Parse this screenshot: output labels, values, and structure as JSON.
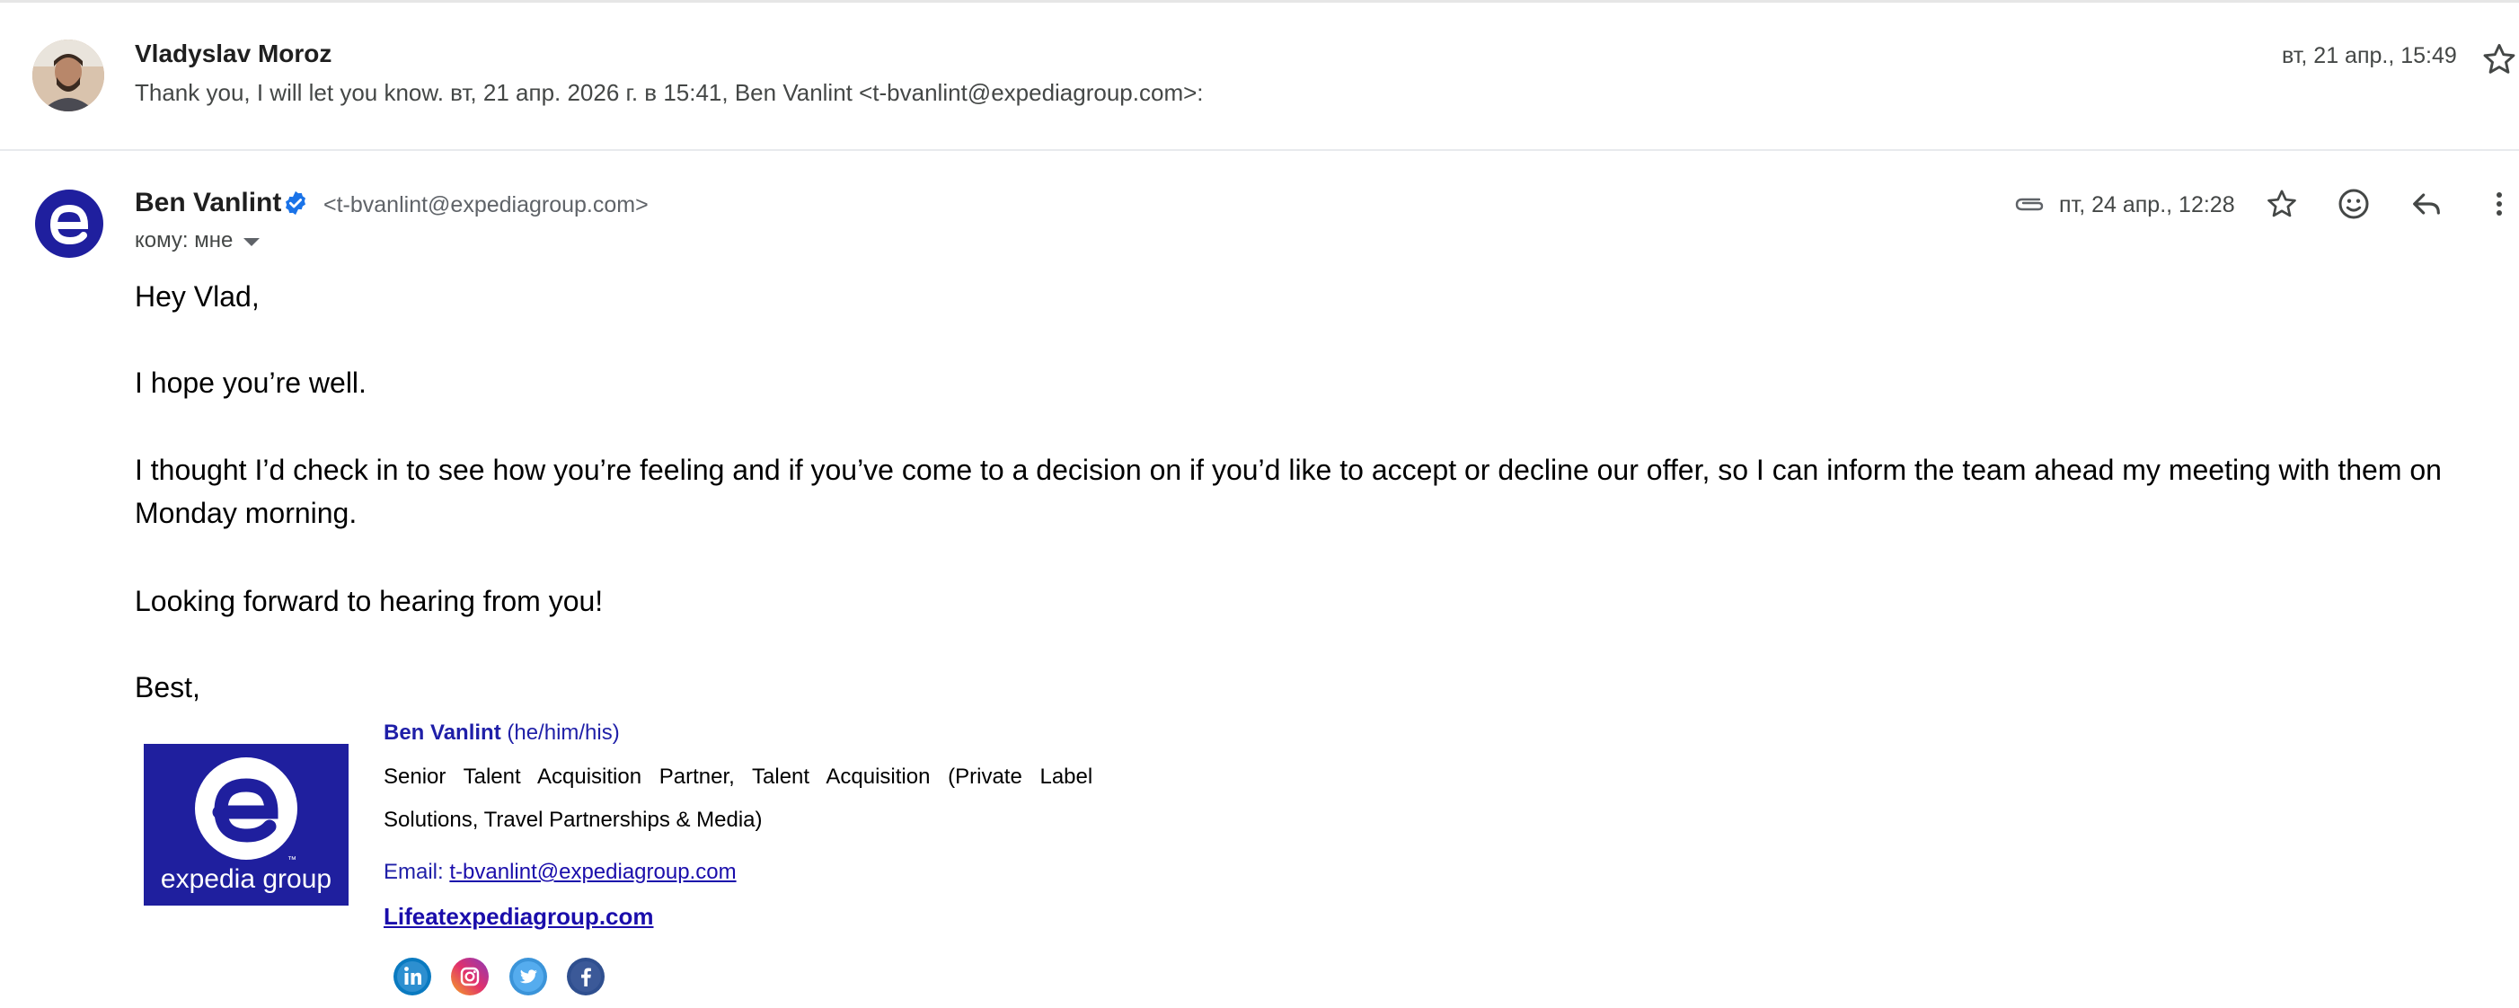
{
  "collapsed_message": {
    "sender": "Vladyslav Moroz",
    "snippet": "Thank you, I will let you know. вт, 21 апр. 2026 г. в 15:41, Ben Vanlint <t-bvanlint@expediagroup.com>:",
    "date": "вт, 21 апр., 15:49"
  },
  "expanded_message": {
    "sender": "Ben Vanlint",
    "sender_email": "<t-bvanlint@expediagroup.com>",
    "to": "кому: мне",
    "date": "пт, 24 апр., 12:28",
    "body": {
      "greeting": "Hey Vlad,",
      "p1": "I hope you’re well.",
      "p2_line1": "I thought I’d check in to see how you’re feeling and if you’ve come to a decision on if you’d like to accept or decline our offer, so I can inform the team ahead my meeting with them on",
      "p2_line2": "Monday morning.",
      "p3": "Looking forward to hearing from you!",
      "closing": "Best,"
    },
    "signature": {
      "logo_text": "expedia group",
      "logo_tm": "™",
      "name": "Ben Vanlint",
      "pronouns": "(he/him/his)",
      "title_line1": "Senior Talent Acquisition Partner, Talent Acquisition (Private Label",
      "title_line2": "Solutions, Travel Partnerships & Media)",
      "email_label": "Email:",
      "email": "t-bvanlint@expediagroup.com",
      "website": "Lifeatexpediagroup.com",
      "social_icons": [
        "linkedin-icon",
        "instagram-icon",
        "twitter-icon",
        "facebook-icon"
      ]
    }
  },
  "colors": {
    "expedia_blue": "#1f1f9e",
    "link_blue": "#1a0dab",
    "verified_blue": "#1a73e8"
  }
}
